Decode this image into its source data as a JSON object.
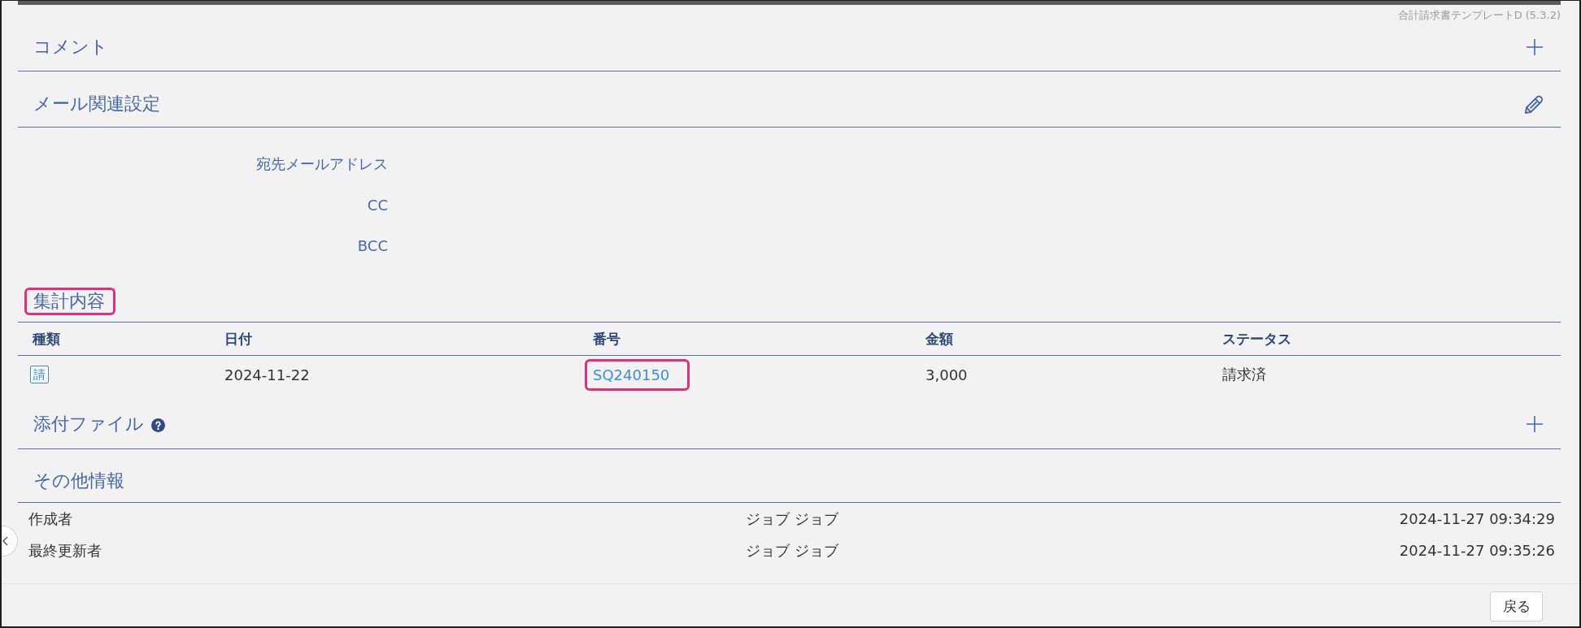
{
  "version_label": "合計請求書テンプレートD (5.3.2)",
  "sections": [
    {
      "kind": "comment",
      "title": "コメント"
    },
    {
      "kind": "mail",
      "title": "メール関連設定",
      "fields": [
        {
          "label": "宛先メールアドレス"
        },
        {
          "label": "CC"
        },
        {
          "label": "BCC"
        }
      ]
    },
    {
      "kind": "summary",
      "title": "集計内容",
      "highlighted": true,
      "table": {
        "columns": [
          "種類",
          "日付",
          "番号",
          "金額",
          "ステータス"
        ],
        "rows": [
          {
            "type_badge": "請",
            "date": "2024-11-22",
            "number": "SQ240150",
            "number_highlighted": true,
            "amount": "3,000",
            "status": "請求済"
          }
        ]
      }
    },
    {
      "kind": "attachments",
      "title": "添付ファイル"
    },
    {
      "kind": "other",
      "title": "その他情報",
      "rows": [
        {
          "label": "作成者",
          "user": "ジョブ ジョブ",
          "timestamp": "2024-11-27 09:34:29"
        },
        {
          "label": "最終更新者",
          "user": "ジョブ ジョブ",
          "timestamp": "2024-11-27 09:35:26"
        }
      ]
    }
  ],
  "footer": {
    "back_button": "戻る"
  }
}
